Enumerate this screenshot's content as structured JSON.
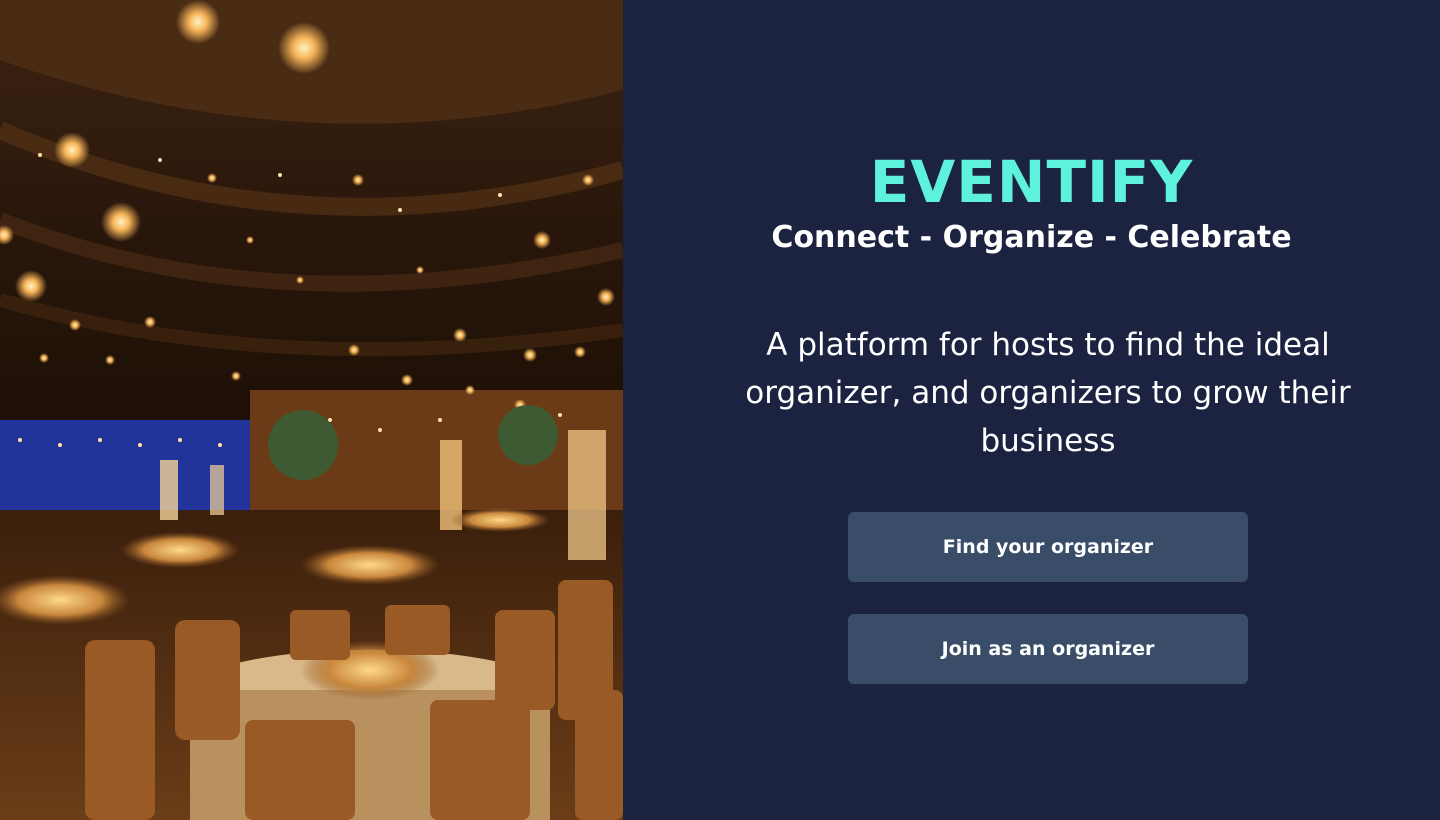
{
  "hero": {
    "image_description_icon": "event-venue-photo"
  },
  "brand": {
    "title": "EVENTIFY",
    "tagline": "Connect - Organize - Celebrate"
  },
  "intro": {
    "description": "A platform for hosts to find the ideal organizer, and organizers to grow their business"
  },
  "actions": {
    "find_label": "Find your organizer",
    "join_label": "Join as an organizer"
  },
  "colors": {
    "background": "#1b2340",
    "accent": "#5ef2dc",
    "button": "#3a4d68"
  }
}
